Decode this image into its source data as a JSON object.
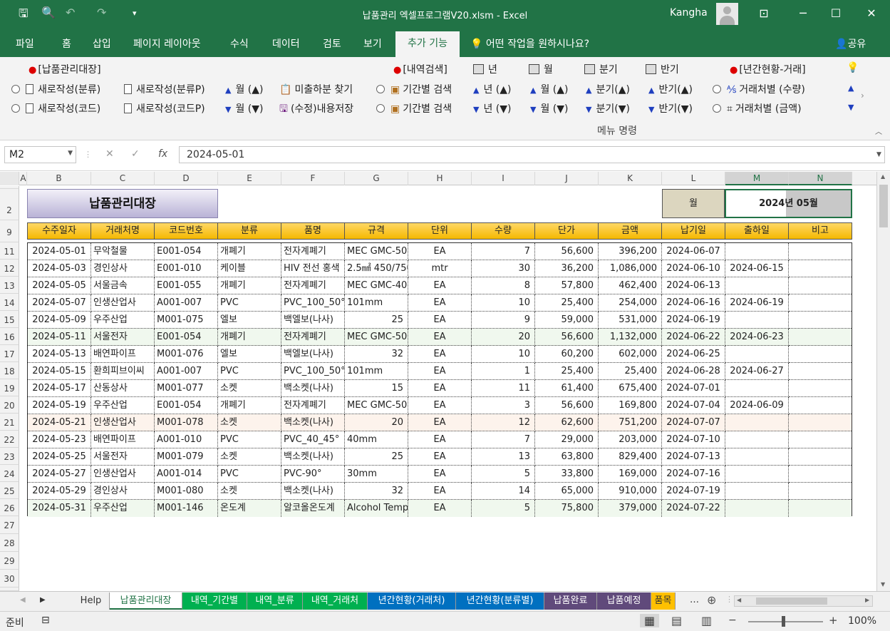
{
  "window": {
    "title": "납품관리 엑셀프로그램V20.xlsm  -  Excel",
    "user": "Kangha"
  },
  "tabs": [
    "파일",
    "홈",
    "삽입",
    "페이지 레이아웃",
    "수식",
    "데이터",
    "검토",
    "보기",
    "추가 기능"
  ],
  "tell_me": "어떤 작업을 원하시나요?",
  "share": "공유",
  "ribbon": {
    "group_label": "메뉴 명령",
    "header_naptum": "[납품관리대장]",
    "new_class": "새로작성(분류)",
    "new_class_p": "새로작성(분류P)",
    "new_code": "새로작성(코드)",
    "new_code_p": "새로작성(코드P)",
    "month_up": "월 (▲)",
    "month_down": "월 (▼)",
    "find_unshipped": "미출하분 찾기",
    "save_edit": "(수정)내용저장",
    "header_search": "[내역검색]",
    "period_search": "기간별 검색",
    "year": "년",
    "month": "월",
    "quarter": "분기",
    "half": "반기",
    "year_up": "년 (▲)",
    "year_down": "년 (▼)",
    "quarter_up": "분기(▲)",
    "quarter_down": "분기(▼)",
    "half_up": "반기(▲)",
    "half_down": "반기(▼)",
    "header_annual": "[년간현황-거래]",
    "by_client_qty": "거래처별 (수량)",
    "by_client_amt": "거래처별 (금액)"
  },
  "formula_bar": {
    "name_box": "M2",
    "value": "2024-05-01"
  },
  "columns": [
    "A",
    "B",
    "C",
    "D",
    "E",
    "F",
    "G",
    "H",
    "I",
    "J",
    "K",
    "L",
    "M",
    "N"
  ],
  "rows": [
    "1",
    "2",
    "9",
    "11",
    "12",
    "13",
    "14",
    "15",
    "16",
    "17",
    "18",
    "19",
    "20",
    "21",
    "22",
    "23",
    "24",
    "25",
    "26",
    "27",
    "28",
    "29",
    "30"
  ],
  "sheet": {
    "title": "납품관리대장",
    "month_label": "월",
    "month_value": "2024년 05월",
    "headers": [
      "수주일자",
      "거래처명",
      "코드번호",
      "분류",
      "품명",
      "규격",
      "단위",
      "수량",
      "단가",
      "금액",
      "납기일",
      "출하일",
      "비고"
    ],
    "data": [
      [
        "2024-05-01",
        "무악철물",
        "E001-054",
        "개폐기",
        "전자계폐기",
        "MEC GMC-50",
        "EA",
        "7",
        "56,600",
        "396,200",
        "2024-06-07",
        "",
        ""
      ],
      [
        "2024-05-03",
        "경인상사",
        "E001-010",
        "케이블",
        "HIV  전선 홍색",
        "2.5㎟ 450/750V",
        "mtr",
        "30",
        "36,200",
        "1,086,000",
        "2024-06-10",
        "2024-06-15",
        ""
      ],
      [
        "2024-05-05",
        "서울금속",
        "E001-055",
        "개폐기",
        "전자계폐기",
        "MEC GMC-40",
        "EA",
        "8",
        "57,800",
        "462,400",
        "2024-06-13",
        "",
        ""
      ],
      [
        "2024-05-07",
        "인생산업사",
        "A001-007",
        "PVC",
        "PVC_100_50°",
        "101mm",
        "EA",
        "10",
        "25,400",
        "254,000",
        "2024-06-16",
        "2024-06-19",
        ""
      ],
      [
        "2024-05-09",
        "우주산업",
        "M001-075",
        "엘보",
        "백엘보(나사)",
        "25",
        "EA",
        "9",
        "59,000",
        "531,000",
        "2024-06-19",
        "",
        ""
      ],
      [
        "2024-05-11",
        "서울전자",
        "E001-054",
        "개폐기",
        "전자계폐기",
        "MEC GMC-50",
        "EA",
        "20",
        "56,600",
        "1,132,000",
        "2024-06-22",
        "2024-06-23",
        ""
      ],
      [
        "2024-05-13",
        "배연파이프",
        "M001-076",
        "엘보",
        "백엘보(나사)",
        "32",
        "EA",
        "10",
        "60,200",
        "602,000",
        "2024-06-25",
        "",
        ""
      ],
      [
        "2024-05-15",
        "환희피브이씨",
        "A001-007",
        "PVC",
        "PVC_100_50°",
        "101mm",
        "EA",
        "1",
        "25,400",
        "25,400",
        "2024-06-28",
        "2024-06-27",
        ""
      ],
      [
        "2024-05-17",
        "산동상사",
        "M001-077",
        "소켓",
        "백소켓(나사)",
        "15",
        "EA",
        "11",
        "61,400",
        "675,400",
        "2024-07-01",
        "",
        ""
      ],
      [
        "2024-05-19",
        "우주산업",
        "E001-054",
        "개폐기",
        "전자계폐기",
        "MEC GMC-50",
        "EA",
        "3",
        "56,600",
        "169,800",
        "2024-07-04",
        "2024-06-09",
        ""
      ],
      [
        "2024-05-21",
        "인생산업사",
        "M001-078",
        "소켓",
        "백소켓(나사)",
        "20",
        "EA",
        "12",
        "62,600",
        "751,200",
        "2024-07-07",
        "",
        ""
      ],
      [
        "2024-05-23",
        "배연파이프",
        "A001-010",
        "PVC",
        "PVC_40_45°",
        "40mm",
        "EA",
        "7",
        "29,000",
        "203,000",
        "2024-07-10",
        "",
        ""
      ],
      [
        "2024-05-25",
        "서울전자",
        "M001-079",
        "소켓",
        "백소켓(나사)",
        "25",
        "EA",
        "13",
        "63,800",
        "829,400",
        "2024-07-13",
        "",
        ""
      ],
      [
        "2024-05-27",
        "인생산업사",
        "A001-014",
        "PVC",
        "PVC-90°",
        "30mm",
        "EA",
        "5",
        "33,800",
        "169,000",
        "2024-07-16",
        "",
        ""
      ],
      [
        "2024-05-29",
        "경인상사",
        "M001-080",
        "소켓",
        "백소켓(나사)",
        "32",
        "EA",
        "14",
        "65,000",
        "910,000",
        "2024-07-19",
        "",
        ""
      ],
      [
        "2024-05-31",
        "우주산업",
        "M001-146",
        "온도계",
        "알코올온도계",
        "Alcohol Temp",
        "EA",
        "5",
        "75,800",
        "379,000",
        "2024-07-22",
        "",
        ""
      ]
    ]
  },
  "sheet_tabs": [
    {
      "label": "Help",
      "color": "#f0f0f0",
      "text": "#333"
    },
    {
      "label": "납품관리대장",
      "color": "#ffffff",
      "text": "#217346"
    },
    {
      "label": "내역_기간별",
      "color": "#00b050",
      "text": "#ffffff"
    },
    {
      "label": "내역_분류",
      "color": "#00b050",
      "text": "#ffffff"
    },
    {
      "label": "내역_거래처",
      "color": "#00b050",
      "text": "#ffffff"
    },
    {
      "label": "년간현황(거래처)",
      "color": "#0070c0",
      "text": "#ffffff"
    },
    {
      "label": "년간현황(분류별)",
      "color": "#0070c0",
      "text": "#ffffff"
    },
    {
      "label": "납품완료",
      "color": "#604a7b",
      "text": "#ffffff"
    },
    {
      "label": "납품예정",
      "color": "#604a7b",
      "text": "#ffffff"
    },
    {
      "label": "품목",
      "color": "#ffc000",
      "text": "#333333"
    }
  ],
  "status": {
    "ready": "준비",
    "zoom": "100%"
  }
}
